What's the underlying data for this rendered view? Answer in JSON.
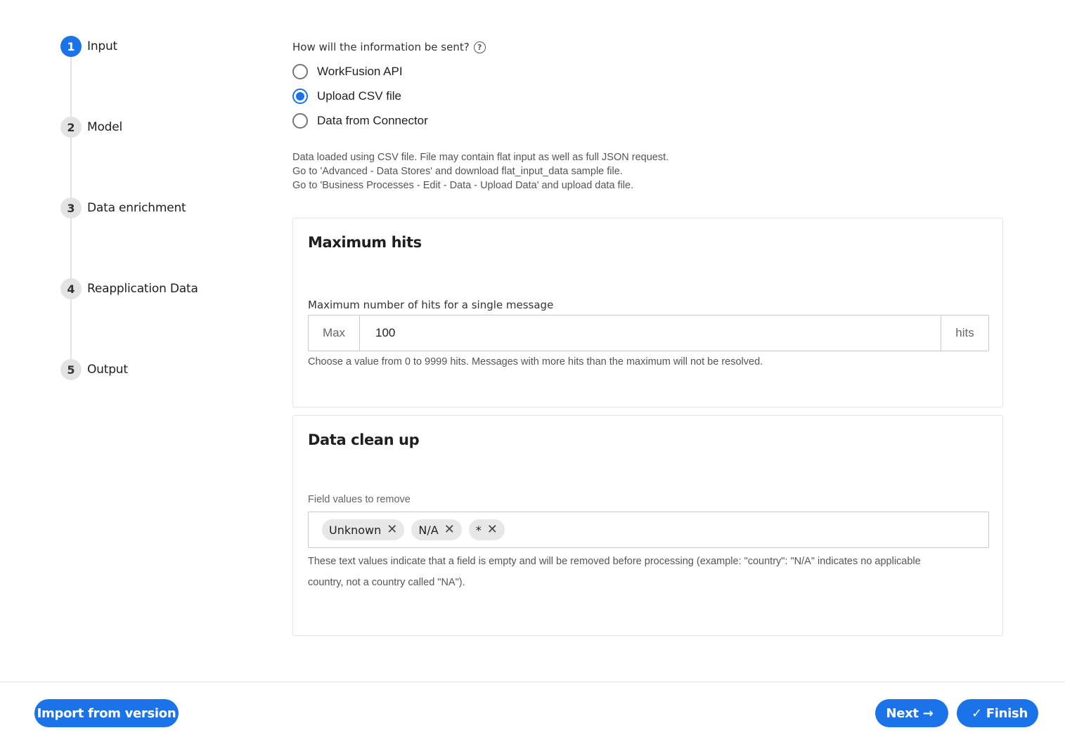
{
  "stepper": {
    "steps": [
      {
        "number": "1",
        "label": "Input",
        "active": true
      },
      {
        "number": "2",
        "label": "Model",
        "active": false
      },
      {
        "number": "3",
        "label": "Data enrichment",
        "active": false
      },
      {
        "number": "4",
        "label": "Reapplication Data",
        "active": false
      },
      {
        "number": "5",
        "label": "Output",
        "active": false
      }
    ]
  },
  "input_method": {
    "question": "How will the information be sent?",
    "help_icon": "?",
    "options": [
      {
        "label": "WorkFusion API",
        "checked": false
      },
      {
        "label": "Upload CSV file",
        "checked": true
      },
      {
        "label": "Data from Connector",
        "checked": false
      }
    ],
    "info_lines": [
      "Data loaded using CSV file. File may contain flat input as well as full JSON request.",
      "Go to 'Advanced - Data Stores' and download flat_input_data sample file.",
      "Go to 'Business Processes - Edit - Data - Upload Data' and upload data file."
    ]
  },
  "max_hits": {
    "title": "Maximum hits",
    "field_label": "Maximum number of hits for a single message",
    "prefix": "Max",
    "value": "100",
    "suffix": "hits",
    "hint": "Choose a value from 0 to 9999 hits. Messages with more hits than the maximum will not be resolved."
  },
  "cleanup": {
    "title": "Data clean up",
    "field_label": "Field values to remove",
    "chips": [
      "Unknown",
      "N/A",
      "*"
    ],
    "chip_remove": "✕",
    "hint_line1": "These text values indicate that a field is empty and will be removed before processing (example: \"country\": \"N/A\" indicates no applicable",
    "hint_line2": "country, not a country called \"NA\")."
  },
  "footer": {
    "import_label": "Import from version",
    "next_label": "Next",
    "next_icon": "→",
    "finish_label": "Finish",
    "finish_icon": "✓"
  },
  "colors": {
    "accent": "#1a73e8",
    "step_inactive": "#e3e3e3",
    "border": "#e4e4e4"
  }
}
